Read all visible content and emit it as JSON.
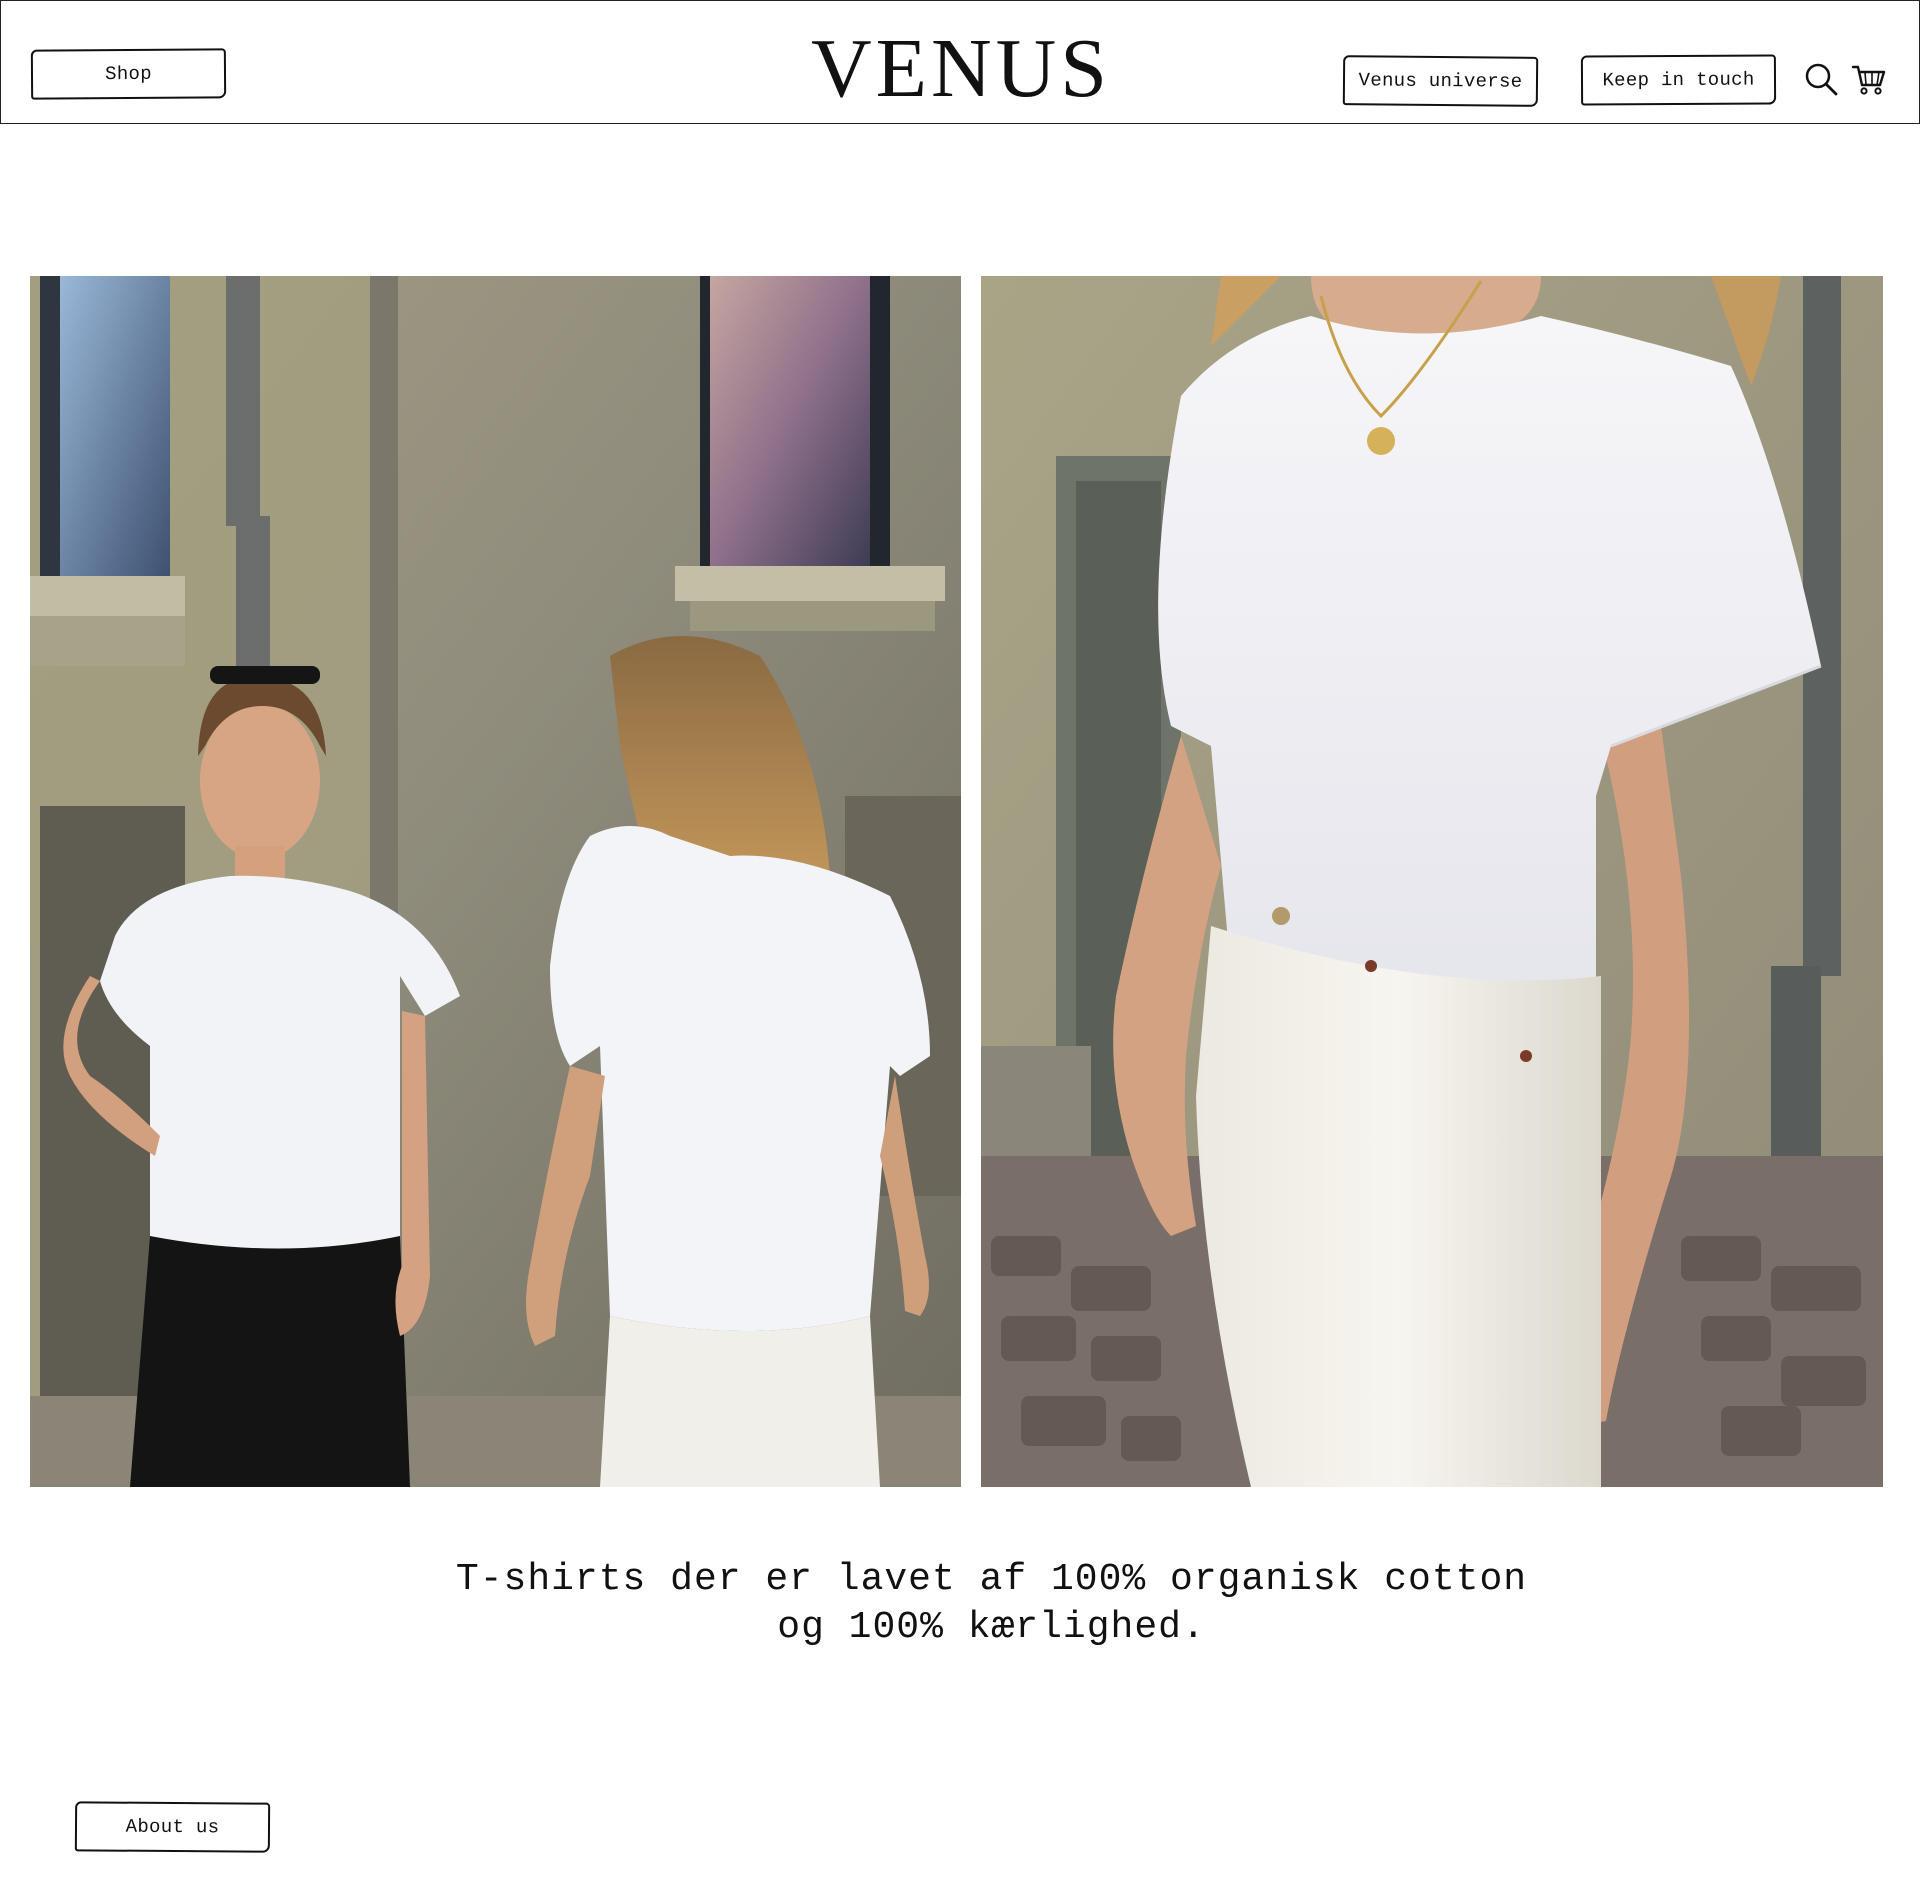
{
  "header": {
    "shop_label": "Shop",
    "logo": "VENUS",
    "universe_label": "Venus universe",
    "touch_label": "Keep in touch",
    "icons": [
      "search-icon",
      "cart-icon"
    ]
  },
  "hero": {
    "images": [
      {
        "name": "two-women-in-white-tshirts-photo"
      },
      {
        "name": "woman-white-tshirt-closeup-photo"
      }
    ]
  },
  "tagline": {
    "line1": "T-shirts der er lavet af 100% organisk cotton",
    "line2": "og 100% kærlighed."
  },
  "footer": {
    "about_label": "About us"
  }
}
